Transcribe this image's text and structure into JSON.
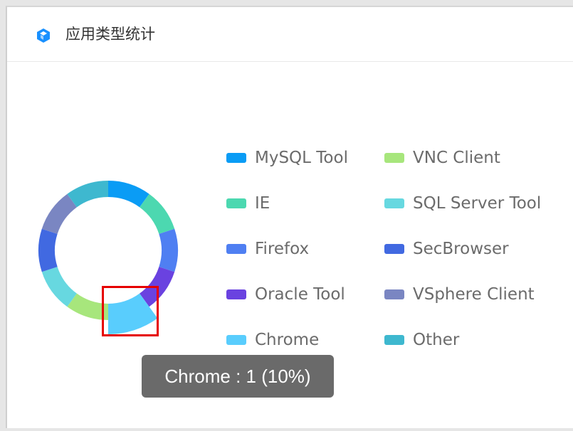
{
  "header": {
    "title": "应用类型统计",
    "icon": "cube-icon",
    "icon_color": "#1890ff"
  },
  "chart_data": {
    "type": "pie",
    "variant": "donut",
    "slices": [
      {
        "label": "MySQL Tool",
        "value": 1,
        "color": "#0a9cf5"
      },
      {
        "label": "IE",
        "value": 1,
        "color": "#4cd8b0"
      },
      {
        "label": "Firefox",
        "value": 1,
        "color": "#4f7ff2"
      },
      {
        "label": "Oracle Tool",
        "value": 1,
        "color": "#6a42e0"
      },
      {
        "label": "Chrome",
        "value": 1,
        "color": "#59cdfd"
      },
      {
        "label": "VNC Client",
        "value": 1,
        "color": "#a7e67c"
      },
      {
        "label": "SQL Server Tool",
        "value": 1,
        "color": "#67d8e0"
      },
      {
        "label": "SecBrowser",
        "value": 1,
        "color": "#4169e1"
      },
      {
        "label": "VSphere Client",
        "value": 1,
        "color": "#7a86c2"
      },
      {
        "label": "Other",
        "value": 1,
        "color": "#3eb8cf"
      }
    ],
    "highlighted": "Chrome",
    "legend_position": "right"
  },
  "legend": {
    "col1": [
      "MySQL Tool",
      "IE",
      "Firefox",
      "Oracle Tool",
      "Chrome"
    ],
    "col2": [
      "VNC Client",
      "SQL Server Tool",
      "SecBrowser",
      "VSphere Client",
      "Other"
    ]
  },
  "tooltip": {
    "text": "Chrome : 1 (10%)"
  }
}
